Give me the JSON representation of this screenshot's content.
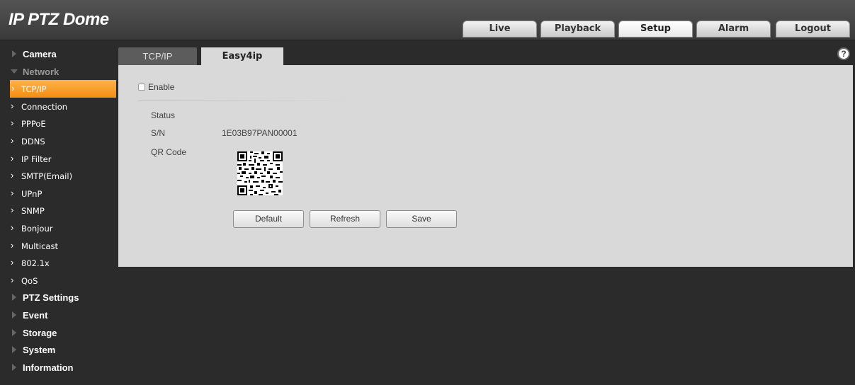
{
  "header": {
    "title": "IP PTZ Dome",
    "nav": [
      "Live",
      "Playback",
      "Setup",
      "Alarm",
      "Logout"
    ],
    "active_nav": "Setup"
  },
  "sidebar": {
    "items": [
      {
        "label": "Camera",
        "type": "category"
      },
      {
        "label": "Network",
        "type": "category-open"
      },
      {
        "label": "TCP/IP",
        "type": "sub",
        "selected": true
      },
      {
        "label": "Connection",
        "type": "sub"
      },
      {
        "label": "PPPoE",
        "type": "sub"
      },
      {
        "label": "DDNS",
        "type": "sub"
      },
      {
        "label": "IP Filter",
        "type": "sub"
      },
      {
        "label": "SMTP(Email)",
        "type": "sub"
      },
      {
        "label": "UPnP",
        "type": "sub"
      },
      {
        "label": "SNMP",
        "type": "sub"
      },
      {
        "label": "Bonjour",
        "type": "sub"
      },
      {
        "label": "Multicast",
        "type": "sub"
      },
      {
        "label": "802.1x",
        "type": "sub"
      },
      {
        "label": "QoS",
        "type": "sub"
      },
      {
        "label": "PTZ Settings",
        "type": "category"
      },
      {
        "label": "Event",
        "type": "category"
      },
      {
        "label": "Storage",
        "type": "category"
      },
      {
        "label": "System",
        "type": "category"
      },
      {
        "label": "Information",
        "type": "category"
      }
    ]
  },
  "tabs": {
    "tcpip": "TCP/IP",
    "easy4ip": "Easy4ip",
    "help": "?"
  },
  "form": {
    "enable_label": "Enable",
    "enable_checked": false,
    "status_label": "Status",
    "status_value": "",
    "sn_label": "S/N",
    "sn_value": "1E03B97PAN00001",
    "qr_label": "QR Code",
    "buttons": {
      "default": "Default",
      "refresh": "Refresh",
      "save": "Save"
    }
  },
  "colors": {
    "accent": "#f28d12",
    "panel": "#d9d9d9",
    "background": "#2b2b2b"
  }
}
